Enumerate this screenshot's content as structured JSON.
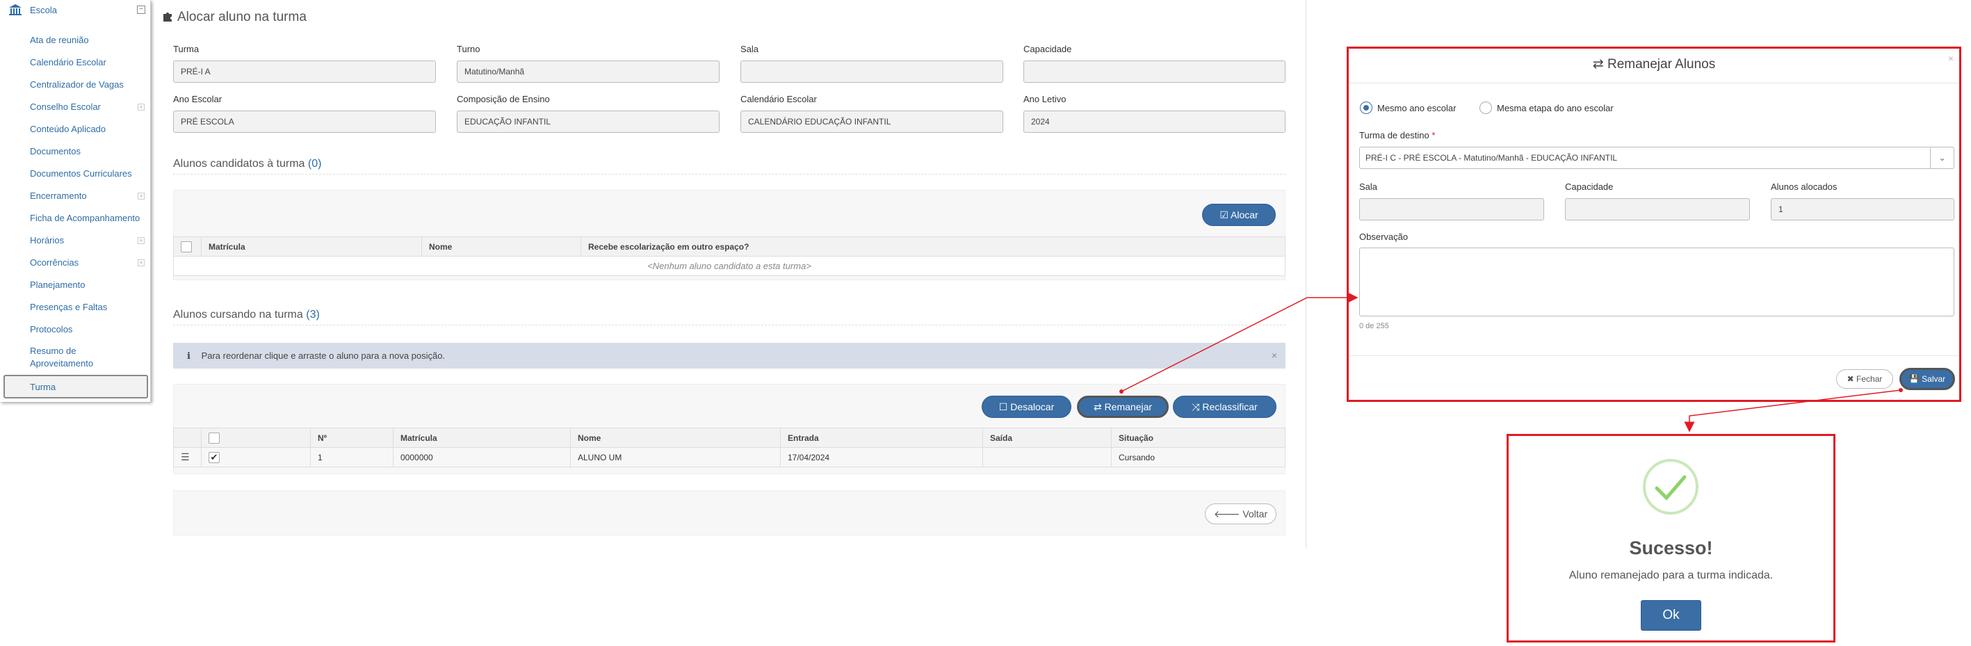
{
  "sidebar": {
    "header": "Escola",
    "items": [
      {
        "label": "Ata de reunião",
        "expandable": false
      },
      {
        "label": "Calendário Escolar",
        "expandable": false
      },
      {
        "label": "Centralizador de Vagas",
        "expandable": false
      },
      {
        "label": "Conselho Escolar",
        "expandable": true
      },
      {
        "label": "Conteúdo Aplicado",
        "expandable": false
      },
      {
        "label": "Documentos",
        "expandable": false
      },
      {
        "label": "Documentos Curriculares",
        "expandable": false
      },
      {
        "label": "Encerramento",
        "expandable": true
      },
      {
        "label": "Ficha de Acompanhamento",
        "expandable": false
      },
      {
        "label": "Horários",
        "expandable": true
      },
      {
        "label": "Ocorrências",
        "expandable": true
      },
      {
        "label": "Planejamento",
        "expandable": false
      },
      {
        "label": "Presenças e Faltas",
        "expandable": false
      },
      {
        "label": "Protocolos",
        "expandable": false
      },
      {
        "label": "Resumo de Aproveitamento",
        "expandable": false
      },
      {
        "label": "Turma",
        "expandable": false
      }
    ]
  },
  "main": {
    "title": "Alocar aluno na turma",
    "fields": {
      "turma": {
        "label": "Turma",
        "value": "PRÉ-I A"
      },
      "turno": {
        "label": "Turno",
        "value": "Matutino/Manhã"
      },
      "sala": {
        "label": "Sala",
        "value": ""
      },
      "capacidade": {
        "label": "Capacidade",
        "value": ""
      },
      "ano_escolar": {
        "label": "Ano Escolar",
        "value": "PRÉ ESCOLA"
      },
      "composicao": {
        "label": "Composição de Ensino",
        "value": "EDUCAÇÃO INFANTIL"
      },
      "calendario": {
        "label": "Calendário Escolar",
        "value": "CALENDÁRIO EDUCAÇÃO INFANTIL"
      },
      "ano_letivo": {
        "label": "Ano Letivo",
        "value": "2024"
      }
    },
    "candidatos": {
      "title": "Alunos candidatos à turma",
      "count": "(0)",
      "alocar_label": "Alocar",
      "columns": [
        "Matrícula",
        "Nome",
        "Recebe escolarização em outro espaço?"
      ],
      "empty_text": "<Nenhum aluno candidato a esta turma>"
    },
    "cursando": {
      "title": "Alunos cursando na turma",
      "count": "(3)",
      "alert": "Para reordenar clique e arraste o aluno para a nova posição.",
      "buttons": {
        "desalocar": "Desalocar",
        "remanejar": "Remanejar",
        "reclassificar": "Reclassificar"
      },
      "columns": [
        "Nº",
        "Matrícula",
        "Nome",
        "Entrada",
        "Saída",
        "Situação"
      ],
      "rows": [
        {
          "num": "1",
          "matricula": "0000000",
          "nome": "ALUNO UM",
          "entrada": "17/04/2024",
          "saida": "",
          "situacao": "Cursando"
        }
      ]
    },
    "voltar_label": "Voltar"
  },
  "modal": {
    "title": "Remanejar Alunos",
    "close": "×",
    "radio_same_year": "Mesmo ano escolar",
    "radio_same_stage": "Mesma etapa do ano escolar",
    "turma_destino_label": "Turma de destino",
    "required_mark": "*",
    "turma_destino_value": "PRÉ-I C - PRÉ ESCOLA - Matutino/Manhã - EDUCAÇÃO INFANTIL",
    "sala_label": "Sala",
    "sala_value": "",
    "capacidade_label": "Capacidade",
    "capacidade_value": "",
    "alunos_alocados_label": "Alunos alocados",
    "alunos_alocados_value": "1",
    "observacao_label": "Observação",
    "counter": "0 de 255",
    "fechar_label": "Fechar",
    "salvar_label": "Salvar"
  },
  "success": {
    "title": "Sucesso!",
    "message": "Aluno remanejado para a turma indicada.",
    "ok_label": "Ok"
  },
  "colors": {
    "primary": "#3a6ea5",
    "link": "#2f6da6",
    "highlight": "#e01b24",
    "success": "#8cd36a"
  }
}
